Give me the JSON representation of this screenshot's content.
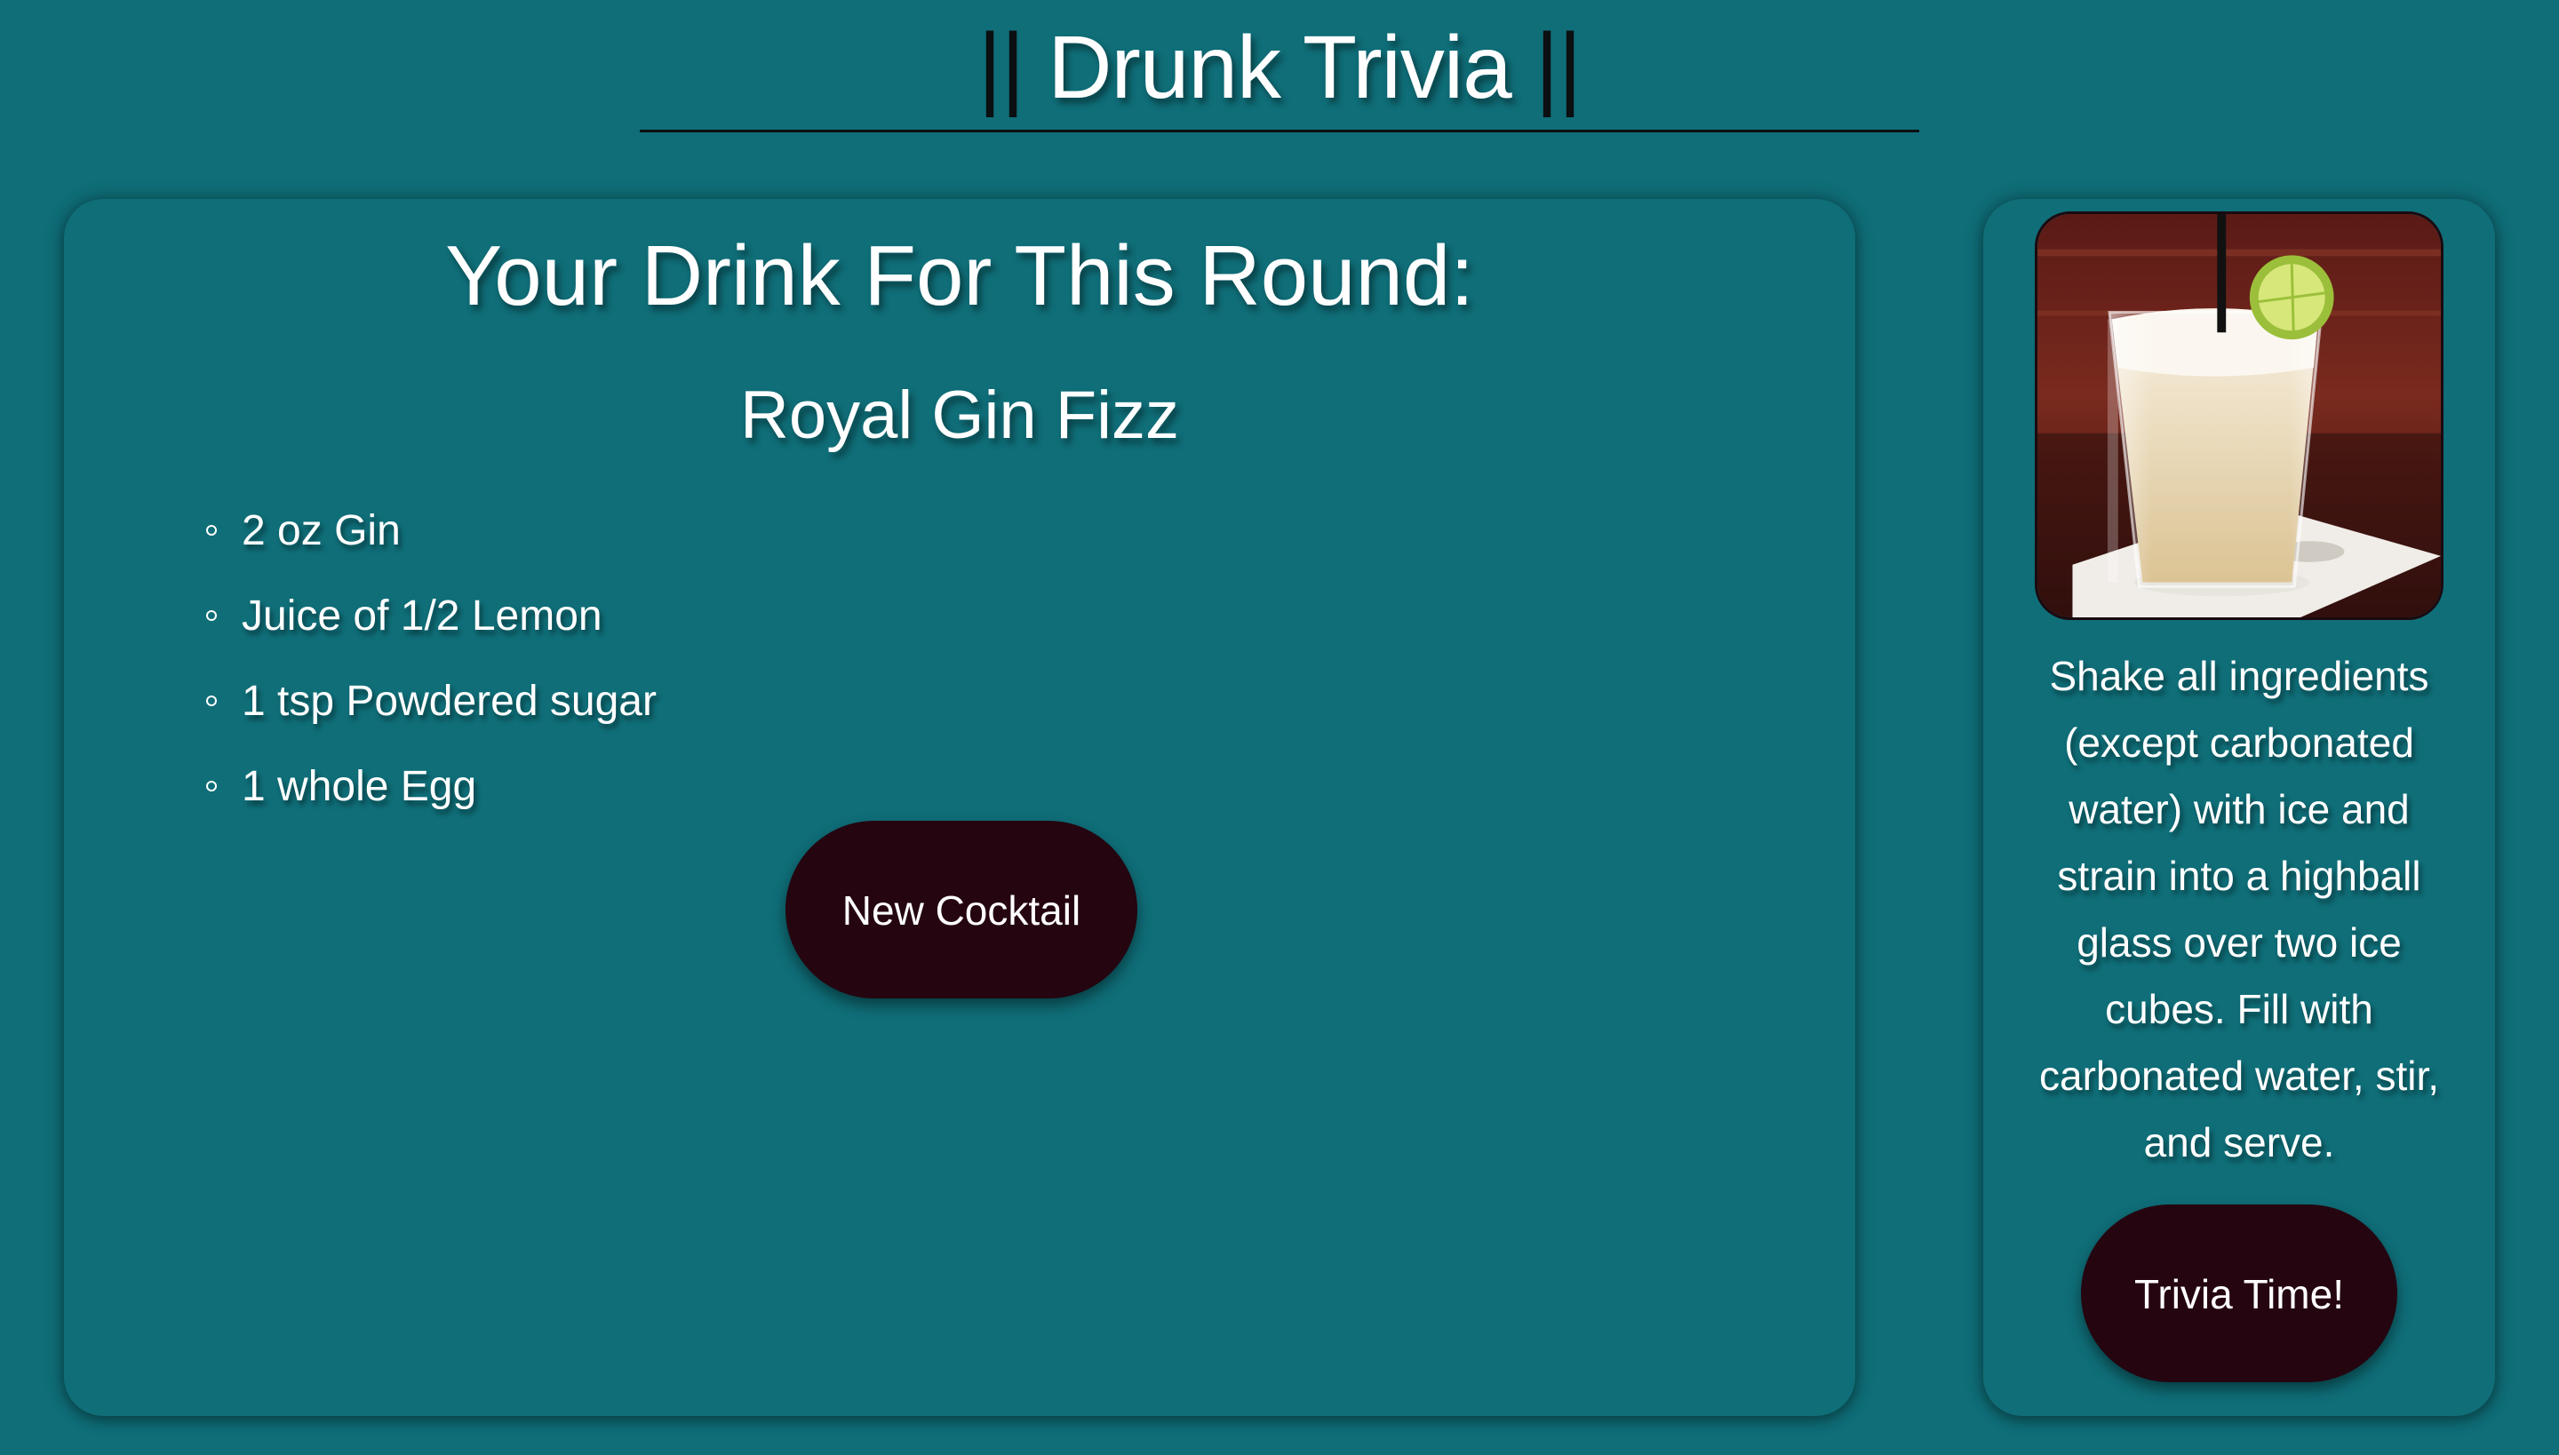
{
  "header": {
    "title_prefix": "||",
    "title": "Drunk Trivia",
    "title_suffix": "||"
  },
  "drink_panel": {
    "heading": "Your Drink For This Round:",
    "drink_name": "Royal Gin Fizz",
    "ingredients": [
      "2 oz Gin",
      "Juice of 1/2 Lemon",
      "1 tsp Powdered sugar",
      "1 whole Egg"
    ],
    "new_cocktail_label": "New Cocktail"
  },
  "side_panel": {
    "image_icon": "cocktail-photo",
    "instructions": "Shake all ingredients (except carbonated water) with ice and strain into a highball glass over two ice cubes. Fill with carbonated water, stir, and serve.",
    "trivia_label": "Trivia Time!"
  },
  "colors": {
    "background": "#0f6e78",
    "button": "#240510",
    "text": "#ffffff"
  }
}
